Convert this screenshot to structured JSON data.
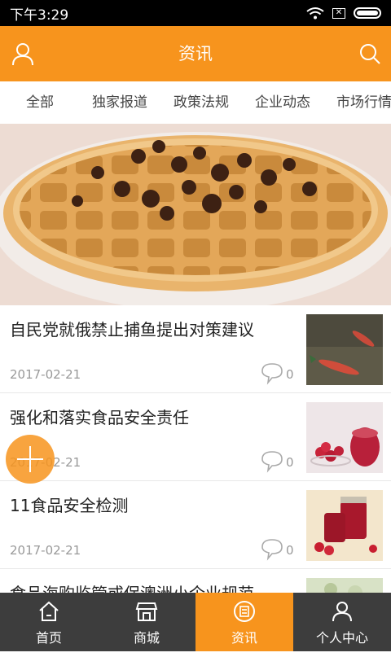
{
  "status": {
    "time": "下午3:29"
  },
  "header": {
    "title": "资讯"
  },
  "tabs": [
    "全部",
    "独家报道",
    "政策法规",
    "企业动态",
    "市场行情"
  ],
  "news": [
    {
      "title": "自民党就俄禁止捕鱼提出对策建议",
      "date": "2017-02-21",
      "comments": "0"
    },
    {
      "title": "强化和落实食品安全责任",
      "date": "2017-02-21",
      "comments": "0"
    },
    {
      "title": "11食品安全检测",
      "date": "2017-02-21",
      "comments": "0"
    },
    {
      "title": "食品海购监管或保澳洲小企业规范",
      "date": "",
      "comments": ""
    }
  ],
  "nav": [
    {
      "label": "首页",
      "icon": "home-icon"
    },
    {
      "label": "商城",
      "icon": "shop-icon"
    },
    {
      "label": "资讯",
      "icon": "news-icon"
    },
    {
      "label": "个人中心",
      "icon": "user-icon"
    }
  ],
  "colors": {
    "accent": "#f7941d",
    "nav_bg": "#3d3d3d"
  }
}
